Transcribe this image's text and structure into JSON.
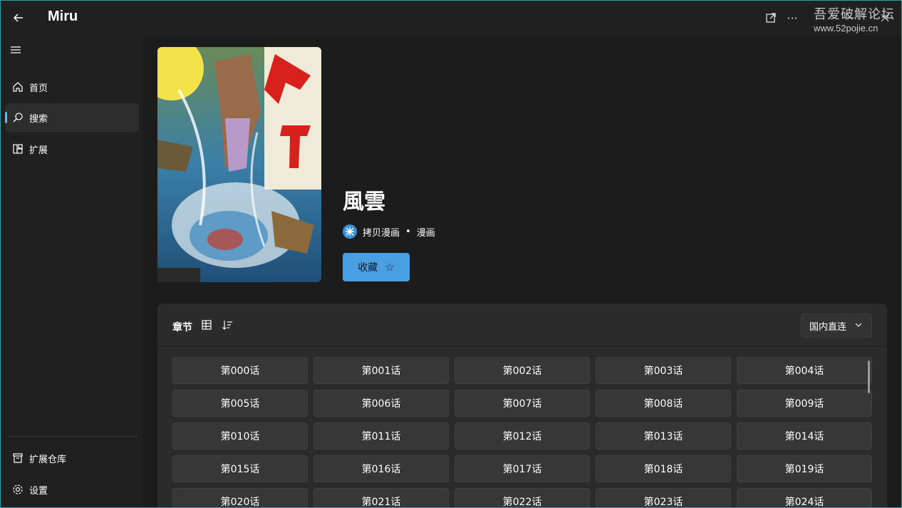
{
  "app": {
    "title": "Miru"
  },
  "watermark": {
    "line1": "吾爱破解论坛",
    "line2": "www.52pojie.cn"
  },
  "titlebar": {
    "icons": [
      "back-arrow-icon",
      "open-external-icon",
      "more-icon",
      "minimize-icon",
      "close-icon"
    ]
  },
  "sidebar": {
    "items": [
      {
        "label": "首页",
        "icon": "home-icon"
      },
      {
        "label": "搜索",
        "icon": "search-icon",
        "active": true
      },
      {
        "label": "扩展",
        "icon": "extensions-icon"
      }
    ],
    "bottom_items": [
      {
        "label": "扩展仓库",
        "icon": "store-icon"
      },
      {
        "label": "设置",
        "icon": "gear-icon"
      }
    ]
  },
  "detail": {
    "title": "風雲",
    "source_name": "拷贝漫画",
    "type": "漫画",
    "favorite_label": "收藏"
  },
  "chapters": {
    "header": "章节",
    "line_select": "国内直连",
    "items": [
      "第000话",
      "第001话",
      "第002话",
      "第003话",
      "第004话",
      "第005话",
      "第006话",
      "第007话",
      "第008话",
      "第009话",
      "第010话",
      "第011话",
      "第012话",
      "第013话",
      "第014话",
      "第015话",
      "第016话",
      "第017话",
      "第018话",
      "第019话",
      "第020话",
      "第021话",
      "第022话",
      "第023话",
      "第024话"
    ]
  },
  "colors": {
    "accent": "#4cc2ff",
    "button_blue": "#4a9fe3",
    "background": "#202020",
    "panel": "#2b2b2b"
  }
}
